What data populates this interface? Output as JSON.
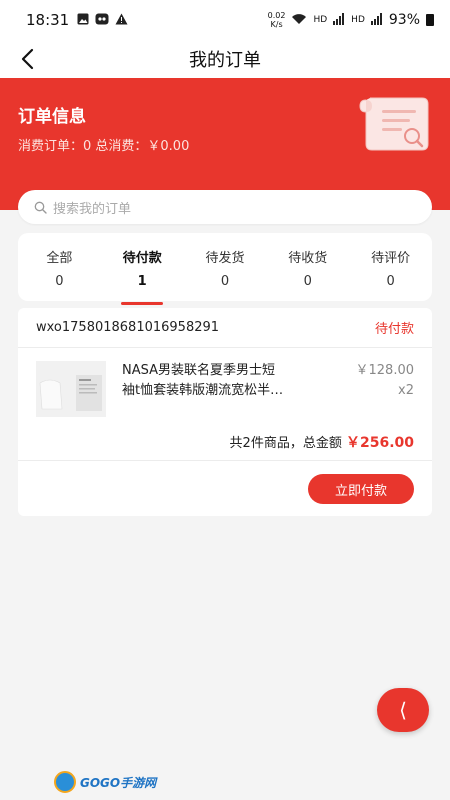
{
  "status_bar": {
    "time": "18:31",
    "net_speed_value": "0.02",
    "net_speed_unit": "K/s",
    "hd1": "HD",
    "hd2": "HD",
    "battery": "93%"
  },
  "nav": {
    "title": "我的订单"
  },
  "header": {
    "title": "订单信息",
    "summary": "消费订单：0 总消费：￥0.00"
  },
  "search": {
    "placeholder": "搜索我的订单"
  },
  "tabs": [
    {
      "label": "全部",
      "count": "0"
    },
    {
      "label": "待付款",
      "count": "1"
    },
    {
      "label": "待发货",
      "count": "0"
    },
    {
      "label": "待收货",
      "count": "0"
    },
    {
      "label": "待评价",
      "count": "0"
    }
  ],
  "order": {
    "id": "wxo1758018681016958291",
    "status": "待付款",
    "product": {
      "name_line1": "NASA男装联名夏季男士短",
      "name_line2": "袖t恤套装韩版潮流宽松半…",
      "price": "￥128.00",
      "qty": "x2",
      "thumb_caption": "PRODUCT DETAILS"
    },
    "total_label": "共2件商品，总金额",
    "total_amount": "￥256.00",
    "pay_button": "立即付款"
  },
  "float_button": {
    "icon": "chevron-left-icon",
    "glyph": "⟨"
  },
  "watermark": {
    "text": "GOGO手游网"
  },
  "colors": {
    "accent": "#e8362d",
    "background": "#f4f4f4"
  }
}
